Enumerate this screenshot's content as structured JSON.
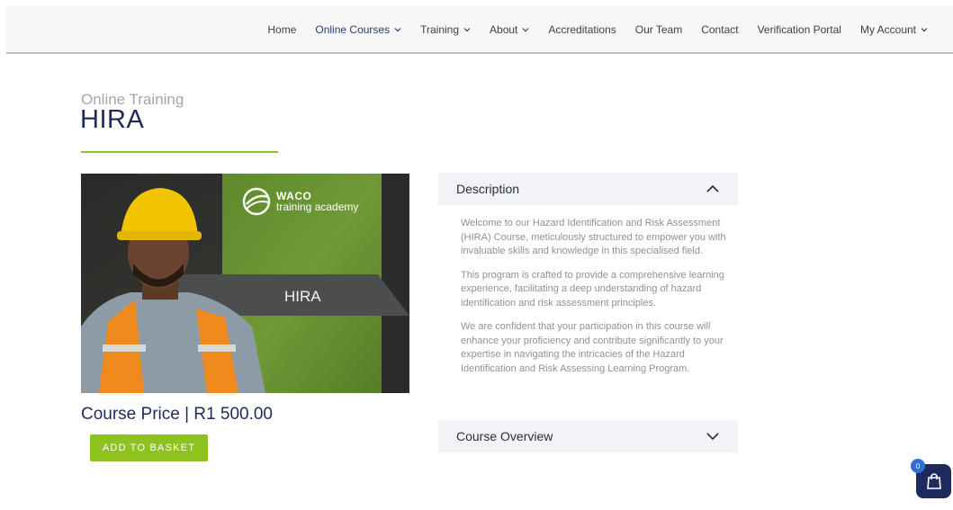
{
  "nav": {
    "items": [
      {
        "label": "Home",
        "has_dropdown": false
      },
      {
        "label": "Online Courses",
        "has_dropdown": true,
        "active": true
      },
      {
        "label": "Training",
        "has_dropdown": true
      },
      {
        "label": "About",
        "has_dropdown": true
      },
      {
        "label": "Accreditations",
        "has_dropdown": false
      },
      {
        "label": "Our Team",
        "has_dropdown": false
      },
      {
        "label": "Contact",
        "has_dropdown": false
      },
      {
        "label": "Verification Portal",
        "has_dropdown": false
      },
      {
        "label": "My Account",
        "has_dropdown": true
      }
    ]
  },
  "page": {
    "subtitle": "Online Training",
    "title": "HIRA"
  },
  "course_image": {
    "brand_line1": "WACO",
    "brand_line2": "training academy",
    "label": "HIRA"
  },
  "product": {
    "price": "Course Price | R1 500.00",
    "add_to_basket_label": "ADD TO BASKET"
  },
  "accordion": {
    "description": {
      "label": "Description",
      "expanded": true,
      "paragraphs": [
        "Welcome to our Hazard Identification and Risk Assessment (HIRA) Course, meticulously structured to empower you with invaluable skills and knowledge in this specialised field.",
        "This program is crafted to provide a comprehensive learning experience, facilitating a deep understanding of hazard identification and risk assessment principles.",
        "We are confident that your participation in this course will enhance your proficiency and contribute significantly to your expertise in navigating the intricacies of the Hazard Identification and Risk Assessing Learning Program."
      ]
    },
    "overview": {
      "label": "Course Overview",
      "expanded": false
    }
  },
  "cart": {
    "count": "0"
  },
  "colors": {
    "accent_green": "#8dc21f",
    "navy": "#1f2a5c",
    "badge_blue": "#2f6fd6"
  }
}
